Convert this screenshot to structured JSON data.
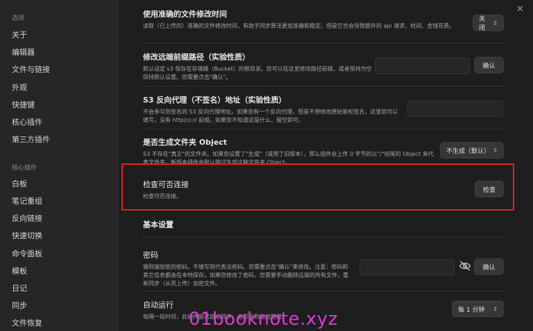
{
  "sidebar": {
    "options_label": "选项",
    "options": [
      "关于",
      "编辑器",
      "文件与链接",
      "外观",
      "快捷键",
      "核心插件",
      "第三方插件"
    ],
    "core_label": "核心插件",
    "core": [
      "白板",
      "笔记重组",
      "反向链接",
      "快速切换",
      "命令面板",
      "模板",
      "日记",
      "同步",
      "文件恢复"
    ]
  },
  "settings": {
    "accurate_mtime": {
      "title": "使用准确的文件修改时间",
      "desc": "读取（已上传的）准确的文件修改时间，有助于同步算法更加准确和稳定。但是它也会导致额外的 api 请求，时间、金钱花费。",
      "value": "关闭"
    },
    "remote_prefix": {
      "title": "修改远端前缀路径（实验性质）",
      "desc": "默认设定 s3 保存在存储桶（Bucket）的根目录。您可以在这里修改路径前缀，或者保持为空保持默认设置。您需要点击\"确认\"。",
      "button": "确认"
    },
    "s3_proxy": {
      "title": "S3 反向代理（不签名）地址（实验性质）",
      "desc": "不会参与到签名的 S3 反向代理地址。如果您有一个反向代理，但是不想修改原始鉴权签名，这里就可以填写。没有 http(s):// 前缀。如果您不知道这是什么，留空即可。"
    },
    "folder_object": {
      "title": "是否生成文件夹 Object",
      "desc": "S3 不存在\"真正\"的文件夹。如果您设置了\"生成\"（或用了旧版本），那么插件会上传 0 字节的以\"/\"结尾的 Object 来代表文件夹。新版本插件会默认跳过生成这种文件夹 Object。",
      "value": "不生成（默认）"
    },
    "check_connection": {
      "title": "检查可否连接",
      "desc": "检查可否连接。",
      "button": "检查"
    },
    "basic_heading": "基本设置",
    "password": {
      "title": "密码",
      "desc": "端到端加密的密码。不填写则代表没密码。您需要点击\"确认\"来修改。注意：密码和其它信息都会在本地保存。如果您修改了密码，您需要手动删除远端的所有文件，重新同步（从而上传）加密文件。",
      "button": "确认"
    },
    "auto_run": {
      "title": "自动运行",
      "desc": "每隔一段时间，此插件尝试自动同步。会影响到电池用量。",
      "value": "每 1 分钟"
    }
  },
  "watermark": "01booknote.xyz",
  "colors": {
    "highlight": "#d62828",
    "watermark": "#e038d4"
  }
}
